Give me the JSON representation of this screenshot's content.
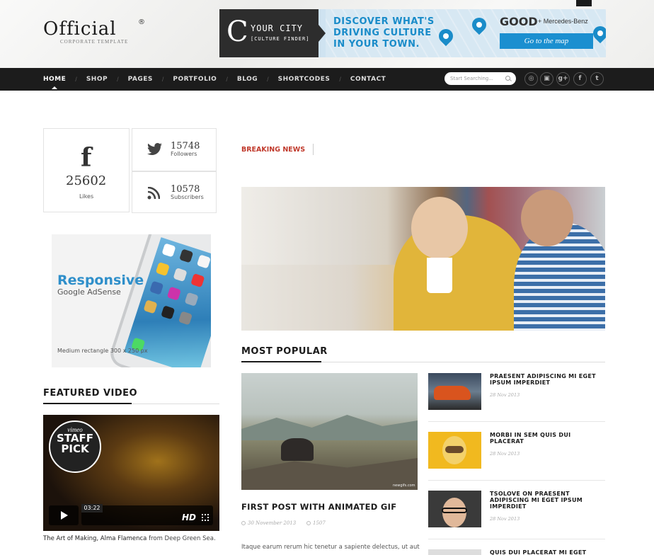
{
  "logo": {
    "title": "Official",
    "registered": "®",
    "subtitle": "CORPORATE TEMPLATE"
  },
  "banner": {
    "brand_letter": "C",
    "brand_name": "YOUR CITY",
    "brand_tag": "[CULTURE FINDER]",
    "headline_1": "DISCOVER WHAT'S",
    "headline_2": "DRIVING CULTURE",
    "headline_3": "IN YOUR TOWN.",
    "partner_1": "GOOD",
    "partner_2": "+ Mercedes-Benz",
    "cta": "Go to the map"
  },
  "nav": {
    "items": [
      {
        "label": "HOME"
      },
      {
        "label": "SHOP"
      },
      {
        "label": "PAGES"
      },
      {
        "label": "PORTFOLIO"
      },
      {
        "label": "BLOG"
      },
      {
        "label": "SHORTCODES"
      },
      {
        "label": "CONTACT"
      }
    ],
    "separator": "/",
    "search_placeholder": "Start Searching...",
    "social_icons": [
      "dribbble-icon",
      "instagram-icon",
      "google-plus-icon",
      "facebook-icon",
      "twitter-icon"
    ],
    "social_glyphs": [
      "◎",
      "▣",
      "g+",
      "f",
      "t"
    ]
  },
  "social_counter": {
    "facebook": {
      "glyph": "f",
      "count": "25602",
      "label": "Likes"
    },
    "twitter": {
      "count": "15748",
      "label": "Followers"
    },
    "rss": {
      "count": "10578",
      "label": "Subscribers"
    }
  },
  "ad": {
    "title": "Responsive",
    "subtitle": "Google AdSense",
    "footer": "Medium rectangle 300 x 250 px"
  },
  "featured_video": {
    "heading": "FEATURED VIDEO",
    "badge_top": "vimeo",
    "badge_line1": "STAFF",
    "badge_line2": "PICK",
    "time": "03:22",
    "hd": "HD",
    "caption_title": "The Art of Making, Alma Flamenca",
    "caption_from": " from Deep Green Sea."
  },
  "breaking_news": {
    "label": "BREAKING NEWS"
  },
  "most_popular": {
    "heading": "MOST POPULAR",
    "main_post": {
      "title": "FIRST POST WITH ANIMATED GIF",
      "date": "30 November 2013",
      "views": "1507",
      "watermark": "newgifs.com",
      "excerpt": "Itaque earum rerum hic tenetur a sapiente delectus, ut aut"
    },
    "side_posts": [
      {
        "title": "PRAESENT ADIPISCING MI EGET IPSUM IMPERDIET",
        "date": "28 Nov 2013"
      },
      {
        "title": "MORBI IN SEM QUIS DUI PLACERAT",
        "date": "28 Nov 2013"
      },
      {
        "title": "TSOLOVE ON PRAESENT ADIPISCING MI EGET IPSUM IMPERDIET",
        "date": "28 Nov 2013"
      },
      {
        "title": "QUIS DUI PLACERAT MI EGET",
        "date": ""
      }
    ]
  },
  "colors": {
    "accent_red": "#c0392b",
    "nav_bg": "#1c1c1c",
    "banner_blue": "#1a8cc9"
  }
}
